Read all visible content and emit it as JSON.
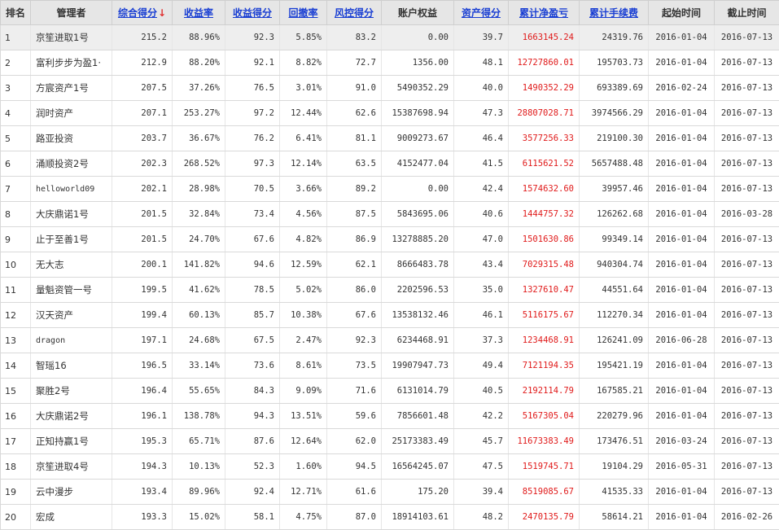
{
  "headers": [
    {
      "label": "排名",
      "sortable": false
    },
    {
      "label": "管理者",
      "sortable": false
    },
    {
      "label": "综合得分",
      "sortable": true,
      "sorted": true,
      "arrow": "↓"
    },
    {
      "label": "收益率",
      "sortable": true
    },
    {
      "label": "收益得分",
      "sortable": true
    },
    {
      "label": "回撤率",
      "sortable": true
    },
    {
      "label": "风控得分",
      "sortable": true
    },
    {
      "label": "账户权益",
      "sortable": false
    },
    {
      "label": "资产得分",
      "sortable": true
    },
    {
      "label": "累计净盈亏",
      "sortable": true
    },
    {
      "label": "累计手续费",
      "sortable": true
    },
    {
      "label": "起始时间",
      "sortable": false
    },
    {
      "label": "截止时间",
      "sortable": false
    }
  ],
  "rows": [
    [
      "1",
      "京笙进取1号",
      "215.2",
      "88.96%",
      "92.3",
      "5.85%",
      "83.2",
      "0.00",
      "39.7",
      "1663145.24",
      "24319.76",
      "2016-01-04",
      "2016-07-13"
    ],
    [
      "2",
      "富利步步为盈1·",
      "212.9",
      "88.20%",
      "92.1",
      "8.82%",
      "72.7",
      "1356.00",
      "48.1",
      "12727860.01",
      "195703.73",
      "2016-01-04",
      "2016-07-13"
    ],
    [
      "3",
      "方宸资产1号",
      "207.5",
      "37.26%",
      "76.5",
      "3.01%",
      "91.0",
      "5490352.29",
      "40.0",
      "1490352.29",
      "693389.69",
      "2016-02-24",
      "2016-07-13"
    ],
    [
      "4",
      "润时资产",
      "207.1",
      "253.27%",
      "97.2",
      "12.44%",
      "62.6",
      "15387698.94",
      "47.3",
      "28807028.71",
      "3974566.29",
      "2016-01-04",
      "2016-07-13"
    ],
    [
      "5",
      "路亚投资",
      "203.7",
      "36.67%",
      "76.2",
      "6.41%",
      "81.1",
      "9009273.67",
      "46.4",
      "3577256.33",
      "219100.30",
      "2016-01-04",
      "2016-07-13"
    ],
    [
      "6",
      "涌顺投资2号",
      "202.3",
      "268.52%",
      "97.3",
      "12.14%",
      "63.5",
      "4152477.04",
      "41.5",
      "6115621.52",
      "5657488.48",
      "2016-01-04",
      "2016-07-13"
    ],
    [
      "7",
      "helloworld09",
      "202.1",
      "28.98%",
      "70.5",
      "3.66%",
      "89.2",
      "0.00",
      "42.4",
      "1574632.60",
      "39957.46",
      "2016-01-04",
      "2016-07-13"
    ],
    [
      "8",
      "大庆鼎诺1号",
      "201.5",
      "32.84%",
      "73.4",
      "4.56%",
      "87.5",
      "5843695.06",
      "40.6",
      "1444757.32",
      "126262.68",
      "2016-01-04",
      "2016-03-28"
    ],
    [
      "9",
      "止于至善1号",
      "201.5",
      "24.70%",
      "67.6",
      "4.82%",
      "86.9",
      "13278885.20",
      "47.0",
      "1501630.86",
      "99349.14",
      "2016-01-04",
      "2016-07-13"
    ],
    [
      "10",
      "无大志",
      "200.1",
      "141.82%",
      "94.6",
      "12.59%",
      "62.1",
      "8666483.78",
      "43.4",
      "7029315.48",
      "940304.74",
      "2016-01-04",
      "2016-07-13"
    ],
    [
      "11",
      "量魁资管一号",
      "199.5",
      "41.62%",
      "78.5",
      "5.02%",
      "86.0",
      "2202596.53",
      "35.0",
      "1327610.47",
      "44551.64",
      "2016-01-04",
      "2016-07-13"
    ],
    [
      "12",
      "汉天资产",
      "199.4",
      "60.13%",
      "85.7",
      "10.38%",
      "67.6",
      "13538132.46",
      "46.1",
      "5116175.67",
      "112270.34",
      "2016-01-04",
      "2016-07-13"
    ],
    [
      "13",
      "dragon",
      "197.1",
      "24.68%",
      "67.5",
      "2.47%",
      "92.3",
      "6234468.91",
      "37.3",
      "1234468.91",
      "126241.09",
      "2016-06-28",
      "2016-07-13"
    ],
    [
      "14",
      "智瑶16",
      "196.5",
      "33.14%",
      "73.6",
      "8.61%",
      "73.5",
      "19907947.73",
      "49.4",
      "7121194.35",
      "195421.19",
      "2016-01-04",
      "2016-07-13"
    ],
    [
      "15",
      "聚胜2号",
      "196.4",
      "55.65%",
      "84.3",
      "9.09%",
      "71.6",
      "6131014.79",
      "40.5",
      "2192114.79",
      "167585.21",
      "2016-01-04",
      "2016-07-13"
    ],
    [
      "16",
      "大庆鼎诺2号",
      "196.1",
      "138.78%",
      "94.3",
      "13.51%",
      "59.6",
      "7856601.48",
      "42.2",
      "5167305.04",
      "220279.96",
      "2016-01-04",
      "2016-07-13"
    ],
    [
      "17",
      "正知持赢1号",
      "195.3",
      "65.71%",
      "87.6",
      "12.64%",
      "62.0",
      "25173383.49",
      "45.7",
      "11673383.49",
      "173476.51",
      "2016-03-24",
      "2016-07-13"
    ],
    [
      "18",
      "京笙进取4号",
      "194.3",
      "10.13%",
      "52.3",
      "1.60%",
      "94.5",
      "16564245.07",
      "47.5",
      "1519745.71",
      "19104.29",
      "2016-05-31",
      "2016-07-13"
    ],
    [
      "19",
      "云中漫步",
      "193.4",
      "89.96%",
      "92.4",
      "12.71%",
      "61.6",
      "175.20",
      "39.4",
      "8519085.67",
      "41535.33",
      "2016-01-04",
      "2016-07-13"
    ],
    [
      "20",
      "宏成",
      "193.3",
      "15.02%",
      "58.1",
      "4.75%",
      "87.0",
      "18914103.61",
      "48.2",
      "2470135.79",
      "58614.21",
      "2016-01-04",
      "2016-02-26"
    ]
  ],
  "highlight_row": 0,
  "colors": {
    "header_link": "#1a3fd3",
    "profit_red": "#e01a1a",
    "sort_arrow": "#e03030"
  }
}
